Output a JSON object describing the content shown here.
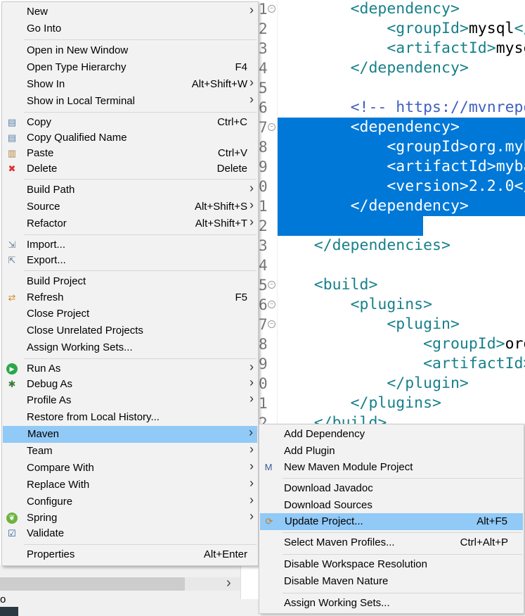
{
  "editor": {
    "line_numbers": [
      "1",
      "2",
      "3",
      "4",
      "5",
      "6",
      "7",
      "8",
      "9",
      "0",
      "1",
      "2",
      "3",
      "4",
      "5",
      "6",
      "7",
      "8",
      "9",
      "0",
      "1",
      "2"
    ],
    "lines": [
      {
        "indent": "        ",
        "parts": [
          {
            "k": "t",
            "v": "<dependency>"
          }
        ]
      },
      {
        "indent": "            ",
        "parts": [
          {
            "k": "t",
            "v": "<groupId>"
          },
          {
            "k": "x",
            "v": "mysql"
          },
          {
            "k": "t",
            "v": "</groupId>"
          }
        ]
      },
      {
        "indent": "            ",
        "parts": [
          {
            "k": "t",
            "v": "<artifactId>"
          },
          {
            "k": "x",
            "v": "mysql"
          }
        ]
      },
      {
        "indent": "        ",
        "parts": [
          {
            "k": "t",
            "v": "</dependency>"
          }
        ]
      },
      {
        "indent": "",
        "parts": []
      },
      {
        "indent": "        ",
        "parts": [
          {
            "k": "c",
            "v": "<!-- https://mvnrepository"
          }
        ]
      },
      {
        "indent": "        ",
        "parts": [
          {
            "k": "t",
            "v": "<dependency>"
          }
        ]
      },
      {
        "indent": "            ",
        "parts": [
          {
            "k": "t",
            "v": "<groupId>"
          },
          {
            "k": "x",
            "v": "org.mybatis"
          }
        ]
      },
      {
        "indent": "            ",
        "parts": [
          {
            "k": "t",
            "v": "<artifactId>"
          },
          {
            "k": "x",
            "v": "mybatis"
          }
        ]
      },
      {
        "indent": "            ",
        "parts": [
          {
            "k": "t",
            "v": "<version>"
          },
          {
            "k": "x",
            "v": "2.2.0"
          },
          {
            "k": "t",
            "v": "</version>"
          }
        ]
      },
      {
        "indent": "        ",
        "parts": [
          {
            "k": "t",
            "v": "</dependency>"
          }
        ]
      },
      {
        "indent": "",
        "parts": []
      },
      {
        "indent": "    ",
        "parts": [
          {
            "k": "t",
            "v": "</dependencies>"
          }
        ]
      },
      {
        "indent": "",
        "parts": []
      },
      {
        "indent": "    ",
        "parts": [
          {
            "k": "t",
            "v": "<build>"
          }
        ]
      },
      {
        "indent": "        ",
        "parts": [
          {
            "k": "t",
            "v": "<plugins>"
          }
        ]
      },
      {
        "indent": "            ",
        "parts": [
          {
            "k": "t",
            "v": "<plugin>"
          }
        ]
      },
      {
        "indent": "                ",
        "parts": [
          {
            "k": "t",
            "v": "<groupId>"
          },
          {
            "k": "x",
            "v": "org"
          }
        ]
      },
      {
        "indent": "                ",
        "parts": [
          {
            "k": "t",
            "v": "<artifactId>"
          }
        ]
      },
      {
        "indent": "            ",
        "parts": [
          {
            "k": "t",
            "v": "</plugin>"
          }
        ]
      },
      {
        "indent": "        ",
        "parts": [
          {
            "k": "t",
            "v": "</plugins>"
          }
        ]
      },
      {
        "indent": "    ",
        "parts": [
          {
            "k": "t",
            "v": "</build>"
          }
        ]
      }
    ],
    "selection_color": "#0078d7"
  },
  "context_menu": {
    "items": [
      {
        "label": "New",
        "submenu": true
      },
      {
        "label": "Go Into"
      },
      {
        "sep": true
      },
      {
        "label": "Open in New Window"
      },
      {
        "label": "Open Type Hierarchy",
        "shortcut": "F4"
      },
      {
        "label": "Show In",
        "shortcut": "Alt+Shift+W",
        "submenu": true
      },
      {
        "label": "Show in Local Terminal",
        "submenu": true
      },
      {
        "sep": true
      },
      {
        "label": "Copy",
        "shortcut": "Ctrl+C",
        "icon": "copy-icon"
      },
      {
        "label": "Copy Qualified Name",
        "icon": "copy-qualified-name-icon"
      },
      {
        "label": "Paste",
        "shortcut": "Ctrl+V",
        "icon": "paste-icon"
      },
      {
        "label": "Delete",
        "shortcut": "Delete",
        "icon": "delete-icon"
      },
      {
        "sep": true
      },
      {
        "label": "Build Path",
        "submenu": true
      },
      {
        "label": "Source",
        "shortcut": "Alt+Shift+S",
        "submenu": true
      },
      {
        "label": "Refactor",
        "shortcut": "Alt+Shift+T",
        "submenu": true
      },
      {
        "sep": true
      },
      {
        "label": "Import...",
        "icon": "import-icon"
      },
      {
        "label": "Export...",
        "icon": "export-icon"
      },
      {
        "sep": true
      },
      {
        "label": "Build Project"
      },
      {
        "label": "Refresh",
        "shortcut": "F5",
        "icon": "refresh-icon"
      },
      {
        "label": "Close Project"
      },
      {
        "label": "Close Unrelated Projects"
      },
      {
        "label": "Assign Working Sets..."
      },
      {
        "sep": true
      },
      {
        "label": "Run As",
        "submenu": true,
        "icon": "run-icon"
      },
      {
        "label": "Debug As",
        "submenu": true,
        "icon": "debug-icon"
      },
      {
        "label": "Profile As",
        "submenu": true
      },
      {
        "label": "Restore from Local History..."
      },
      {
        "label": "Maven",
        "submenu": true,
        "highlighted": true
      },
      {
        "label": "Team",
        "submenu": true
      },
      {
        "label": "Compare With",
        "submenu": true
      },
      {
        "label": "Replace With",
        "submenu": true
      },
      {
        "label": "Configure",
        "submenu": true
      },
      {
        "label": "Spring",
        "submenu": true,
        "icon": "spring-icon"
      },
      {
        "label": "Validate",
        "icon": "checkbox-icon"
      },
      {
        "sep": true
      },
      {
        "label": "Properties",
        "shortcut": "Alt+Enter"
      }
    ]
  },
  "maven_submenu": {
    "items": [
      {
        "label": "Add Dependency"
      },
      {
        "label": "Add Plugin"
      },
      {
        "label": "New Maven Module Project",
        "icon": "maven-module-icon"
      },
      {
        "sep": true
      },
      {
        "label": "Download Javadoc"
      },
      {
        "label": "Download Sources"
      },
      {
        "label": "Update Project...",
        "shortcut": "Alt+F5",
        "icon": "update-project-icon",
        "highlighted": true
      },
      {
        "sep": true
      },
      {
        "label": "Select Maven Profiles...",
        "shortcut": "Ctrl+Alt+P"
      },
      {
        "sep": true
      },
      {
        "label": "Disable Workspace Resolution"
      },
      {
        "label": "Disable Maven Nature"
      },
      {
        "sep": true
      },
      {
        "label": "Assign Working Sets..."
      }
    ]
  },
  "background": {
    "status_fragment": "o",
    "scroll_arrow": "›"
  },
  "colors": {
    "highlight": "#91c9f7",
    "menu_bg": "#f2f2f2"
  }
}
